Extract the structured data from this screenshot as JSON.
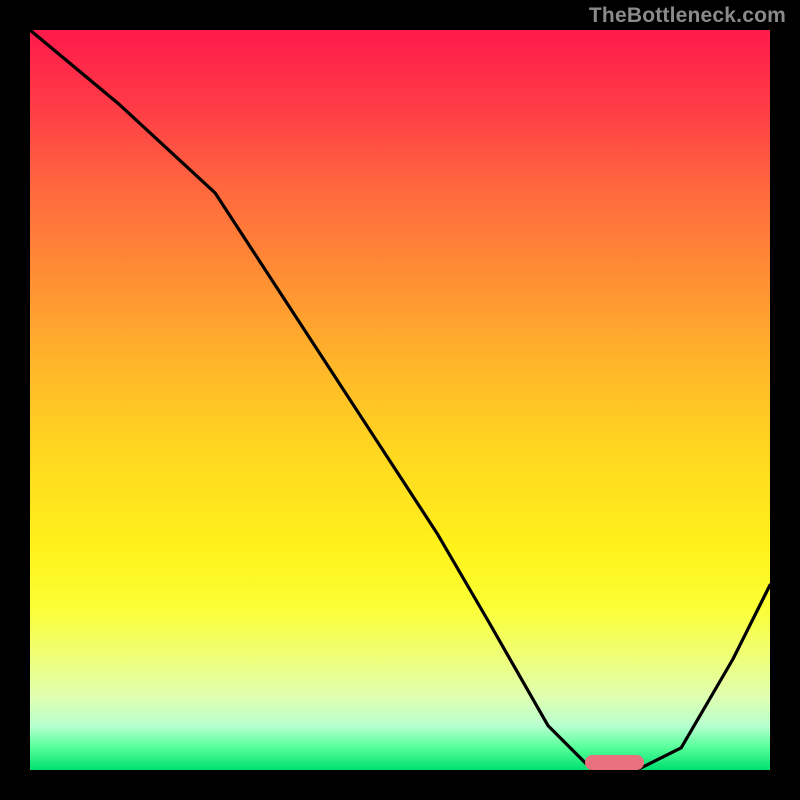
{
  "watermark": "TheBottleneck.com",
  "chart_data": {
    "type": "line",
    "title": "",
    "xlabel": "",
    "ylabel": "",
    "xlim": [
      0,
      100
    ],
    "ylim": [
      0,
      100
    ],
    "series": [
      {
        "name": "bottleneck-curve",
        "x": [
          0,
          12,
          25,
          40,
          55,
          62,
          70,
          76,
          82,
          88,
          95,
          100
        ],
        "values": [
          100,
          90,
          78,
          55,
          32,
          20,
          6,
          0,
          0,
          3,
          15,
          25
        ]
      }
    ],
    "annotations": [
      {
        "name": "optimal-marker",
        "shape": "pill",
        "color": "#e9717e",
        "x": 79,
        "y": 1,
        "width_pct": 8,
        "height_pct": 2
      }
    ],
    "background_gradient": {
      "stops": [
        {
          "pct": 0,
          "color": "#ff1a4b"
        },
        {
          "pct": 22,
          "color": "#ff6a3d"
        },
        {
          "pct": 57,
          "color": "#ffd720"
        },
        {
          "pct": 84,
          "color": "#f0ff70"
        },
        {
          "pct": 100,
          "color": "#00e070"
        }
      ]
    }
  }
}
